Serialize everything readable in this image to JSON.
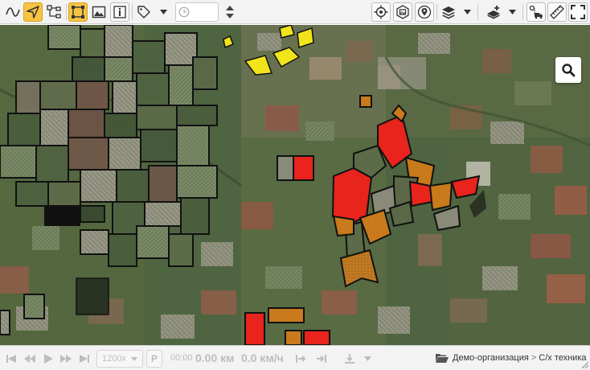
{
  "colors": {
    "toolbar_bg": "#f3f3f3",
    "active_tool": "#f6c344",
    "field_red": "#e8241c",
    "field_orange": "#c87a1c",
    "field_yellow": "#f2e41a",
    "disabled": "#bdbdbd"
  },
  "toolbar": {
    "left_tools": [
      {
        "icon": "polyline-icon",
        "active": false
      },
      {
        "icon": "navigation-arrow-icon",
        "active": true
      },
      {
        "icon": "route-tree-icon",
        "active": false
      },
      {
        "icon": "select-frame-icon",
        "active": false
      },
      {
        "icon": "image-icon",
        "active": false
      },
      {
        "icon": "info-icon",
        "active": false
      },
      {
        "icon": "tag-icon",
        "active": false
      }
    ],
    "time_value": "",
    "right_tools": [
      {
        "icon": "locate-target-icon"
      },
      {
        "icon": "map-image-icon"
      },
      {
        "icon": "map-pin-icon"
      },
      {
        "icon": "layers-icon"
      },
      {
        "icon": "add-layer-icon"
      },
      {
        "icon": "route-truck-icon"
      },
      {
        "icon": "ruler-icon"
      },
      {
        "icon": "fullscreen-icon"
      }
    ]
  },
  "map": {
    "search_icon": "search-icon"
  },
  "bottom_bar": {
    "speed_value": "1200x",
    "p_label": "P",
    "time": "00:00",
    "distance": "0.00 км",
    "speed": "0.0 км/ч",
    "breadcrumb": {
      "organization": "Демо-организация",
      "separator": ">",
      "section": "С/х техника"
    }
  }
}
